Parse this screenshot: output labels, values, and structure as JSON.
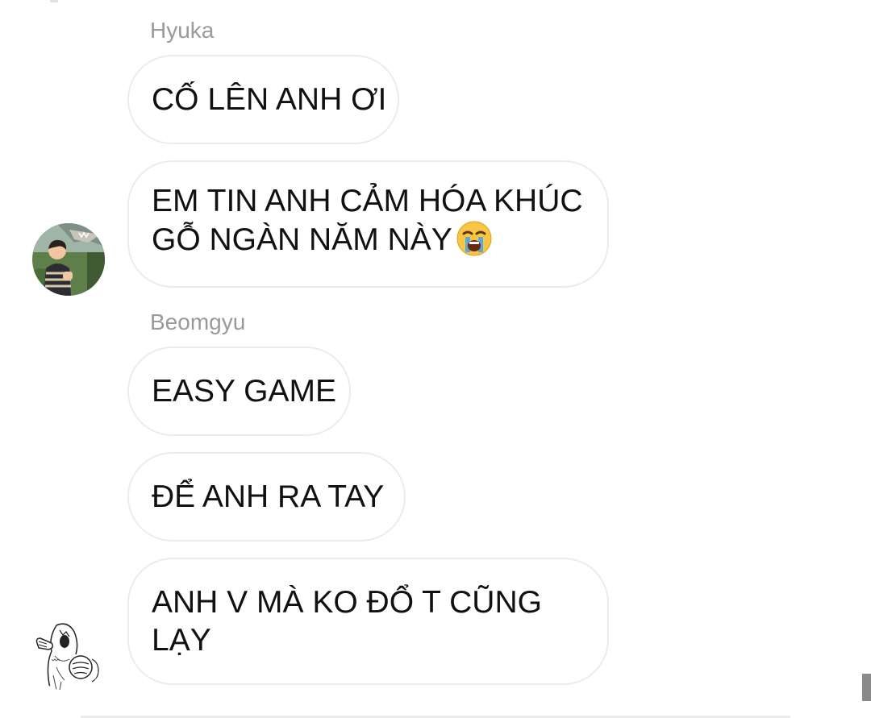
{
  "messages": [
    {
      "sender": "Hyuka",
      "text": "CỐ LÊN ANH ƠI"
    },
    {
      "text": "EM TIN ANH CẢM HÓA KHÚC GỖ NGÀN NĂM NÀY",
      "emoji": "loudly-crying-face"
    },
    {
      "sender": "Beomgyu",
      "text": "EASY GAME"
    },
    {
      "text": "ĐỂ ANH RA TAY"
    },
    {
      "text": "ANH V MÀ KO ĐỔ T CŨNG LẠY"
    }
  ],
  "avatars": [
    {
      "icon": "avatar-photo-boy-with-dinosaur"
    },
    {
      "icon": "avatar-sketch-rage-comic"
    }
  ],
  "colors": {
    "background": "#ffffff",
    "bubble_border": "#ececec",
    "sender_name": "#9a9a9a",
    "message_text": "#111111"
  }
}
